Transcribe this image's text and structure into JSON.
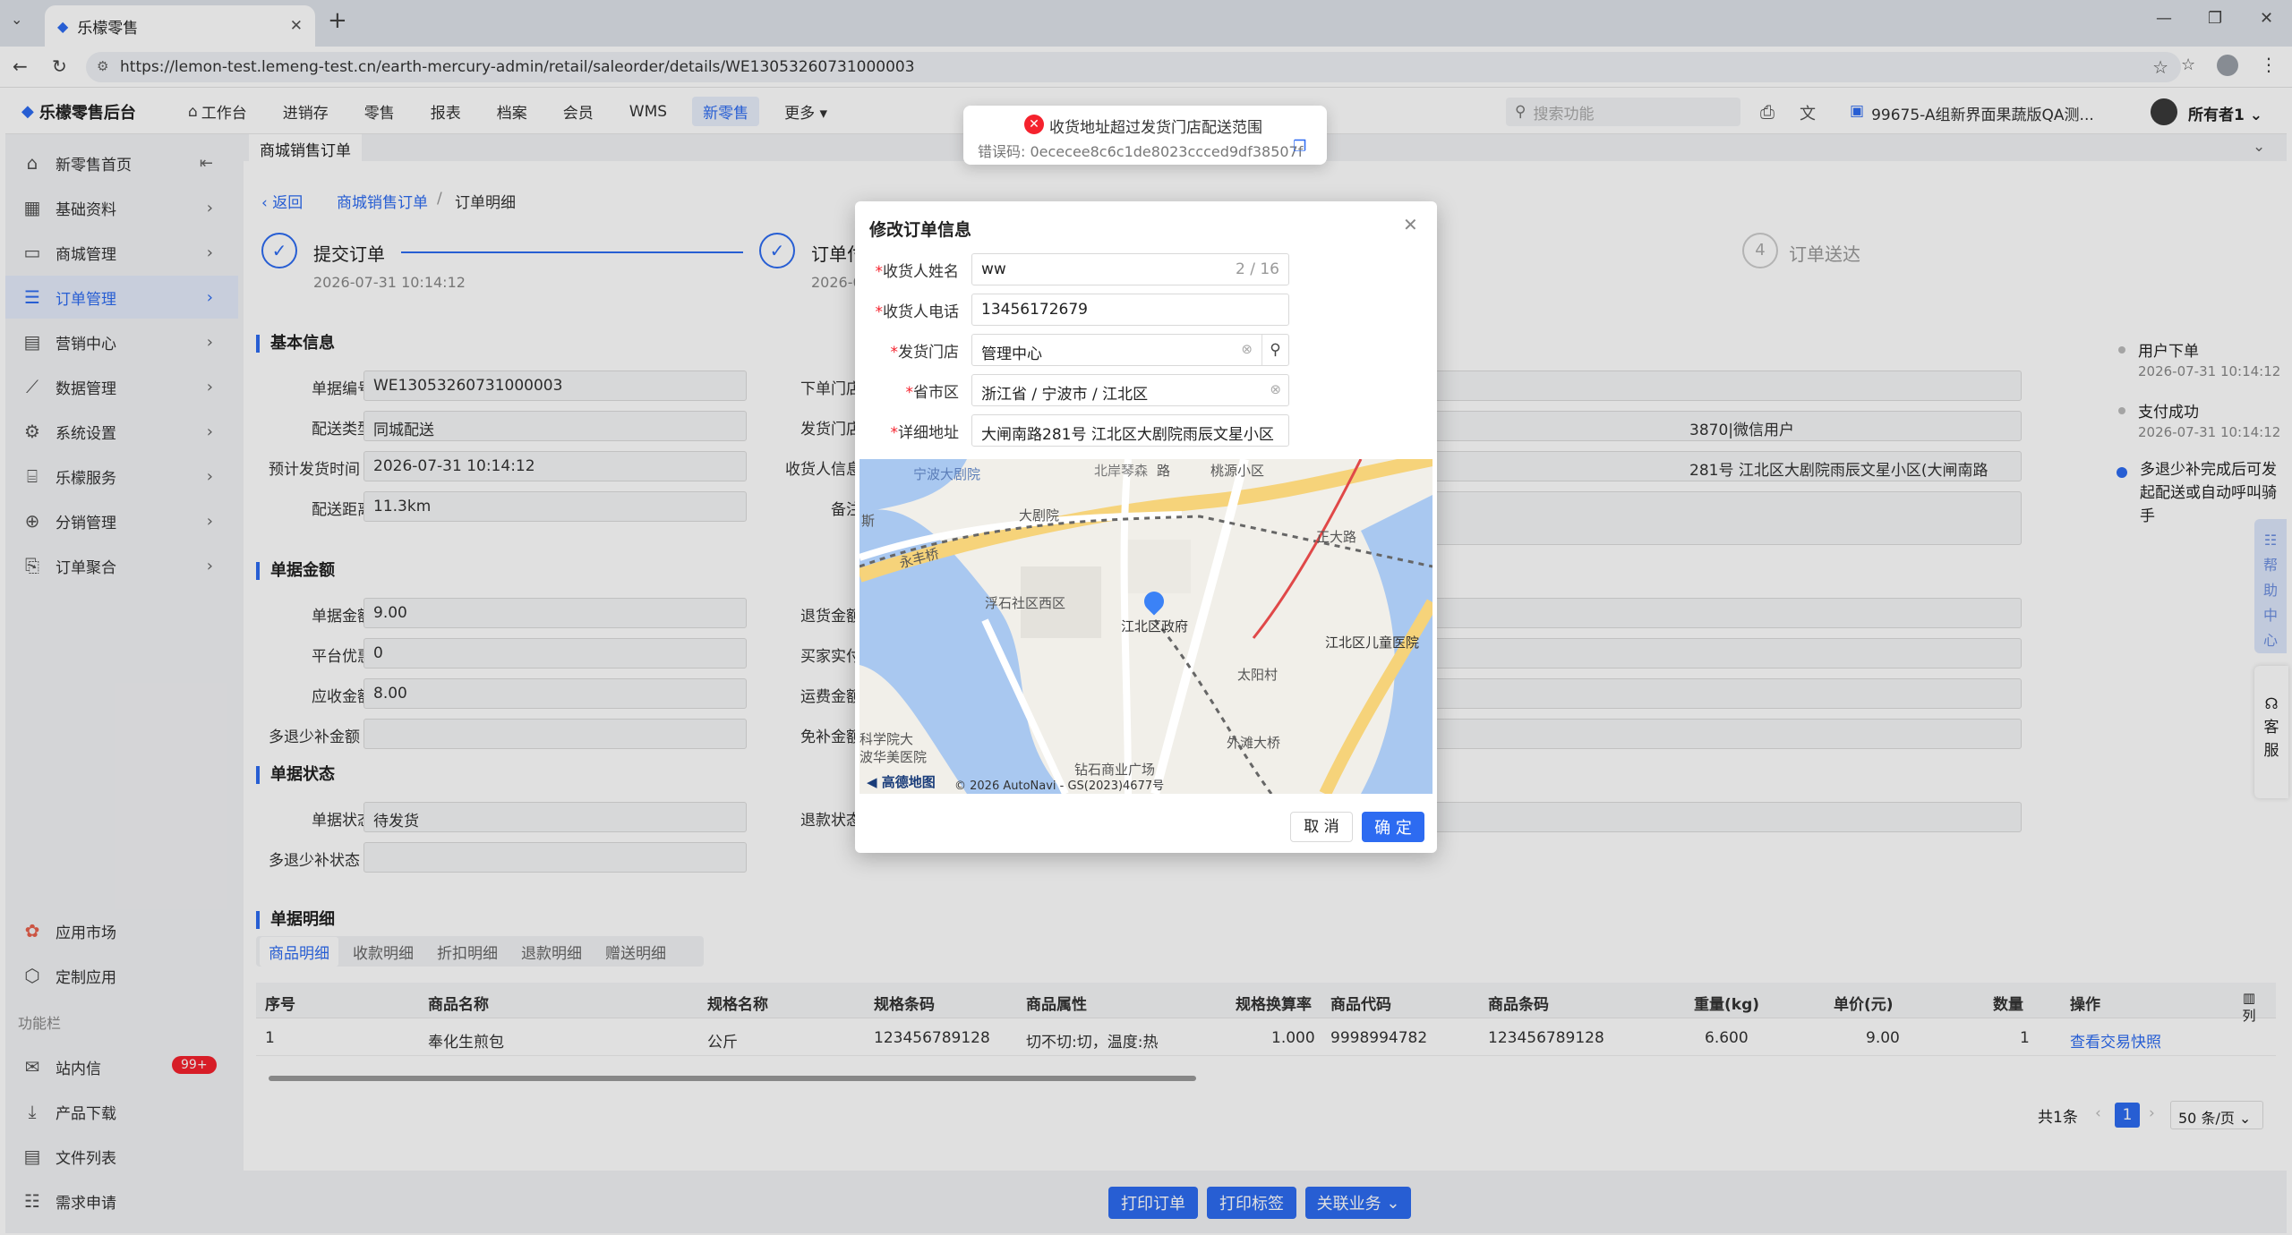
{
  "browser": {
    "tab_title": "乐檬零售",
    "url": "https://lemon-test.lemeng-test.cn/earth-mercury-admin/retail/saleorder/details/WE13053260731000003"
  },
  "app": {
    "logo": "乐檬零售后台",
    "search_placeholder": "搜索功能",
    "org": "99675-A组新界面果蔬版QA测...",
    "user": "所有者1"
  },
  "topnav": [
    "工作台",
    "进销存",
    "零售",
    "报表",
    "档案",
    "会员",
    "WMS",
    "新零售",
    "更多"
  ],
  "sidebar": {
    "items": [
      "新零售首页",
      "基础资料",
      "商城管理",
      "订单管理",
      "营销中心",
      "数据管理",
      "系统设置",
      "乐檬服务",
      "分销管理",
      "订单聚合"
    ],
    "bottom": [
      "应用市场",
      "定制应用"
    ],
    "section": "功能栏",
    "tools": [
      "站内信",
      "产品下载",
      "文件列表",
      "需求申请"
    ],
    "badge": "99+"
  },
  "page": {
    "tab": "商城销售订单",
    "back": "返回",
    "crumb1": "商城销售订单",
    "crumb_sep": "/",
    "crumb2": "订单明细"
  },
  "steps": [
    {
      "label": "提交订单",
      "time": "2026-07-31 10:14:12"
    },
    {
      "label": "订单付",
      "time": "2026-07"
    },
    {
      "num": "4",
      "label": "订单送达"
    }
  ],
  "basic": {
    "title": "基本信息",
    "rows": [
      [
        "单据编号",
        "WE13053260731000003"
      ],
      [
        "配送类型",
        "同城配送"
      ],
      [
        "预计发货时间",
        "2026-07-31 10:14:12"
      ],
      [
        "配送距离",
        "11.3km"
      ]
    ],
    "right_labels": [
      "下单门店",
      "发货门店",
      "收货人信息",
      "备注"
    ],
    "right_values": [
      "",
      "3870|微信用户",
      "281号 江北区大剧院雨辰文星小区(大闸南路",
      ""
    ]
  },
  "amount": {
    "title": "单据金额",
    "rows": [
      [
        "单据金额",
        "9.00"
      ],
      [
        "平台优惠",
        "0"
      ],
      [
        "应收金额",
        "8.00"
      ],
      [
        "多退少补金额",
        ""
      ]
    ],
    "right_labels": [
      "退货金额",
      "买家实付",
      "运费金额",
      "免补金额"
    ]
  },
  "status": {
    "title": "单据状态",
    "rows": [
      [
        "单据状态",
        "待发货"
      ],
      [
        "多退少补状态",
        ""
      ]
    ],
    "right_labels": [
      "退款状态"
    ]
  },
  "detail": {
    "title": "单据明细",
    "tabs": [
      "商品明细",
      "收款明细",
      "折扣明细",
      "退款明细",
      "赠送明细"
    ],
    "columns": [
      "序号",
      "商品名称",
      "规格名称",
      "规格条码",
      "商品属性",
      "规格换算率",
      "商品代码",
      "商品条码",
      "重量(kg)",
      "单价(元)",
      "数量",
      "操作"
    ],
    "row": [
      "1",
      "奉化生煎包",
      "公斤",
      "123456789128",
      "切不切:切，温度:热",
      "1.000",
      "9998994782",
      "123456789128",
      "6.600",
      "9.00",
      "1",
      "查看交易快照"
    ],
    "col_setting": "列",
    "total": "共1条",
    "page": "1",
    "page_size": "50 条/页"
  },
  "timeline": [
    {
      "title": "用户下单",
      "time": "2026-07-31 10:14:12"
    },
    {
      "title": "支付成功",
      "time": "2026-07-31 10:14:12"
    },
    {
      "title": "多退少补完成后可发起配送或自动呼叫骑手",
      "time": ""
    }
  ],
  "footer": {
    "print_order": "打印订单",
    "print_label": "打印标签",
    "related": "关联业务"
  },
  "help": {
    "help": "帮助中心",
    "service": "客服"
  },
  "toast": {
    "message": "收货地址超过发货门店配送范围",
    "error": "错误码: 0ececee8c6c1de8023ccced9df38507f"
  },
  "dialog": {
    "title": "修改订单信息",
    "fields": [
      {
        "label": "收货人姓名",
        "value": "ww",
        "count": "2 / 16"
      },
      {
        "label": "收货人电话",
        "value": "13456172679"
      },
      {
        "label": "发货门店",
        "value": "管理中心"
      },
      {
        "label": "省市区",
        "value": "浙江省 / 宁波市 / 江北区"
      },
      {
        "label": "详细地址",
        "value": "大闸南路281号 江北区大剧院雨辰文星小区"
      }
    ],
    "cancel": "取 消",
    "ok": "确 定"
  },
  "map": {
    "labels": [
      "宁波大剧院",
      "北岸琴森",
      "桃源小区",
      "大剧院",
      "正大路",
      "永丰桥",
      "浮石社区西区",
      "江北区政府",
      "江北区儿童医院",
      "太阳村",
      "外滩大桥",
      "钻石商业广场",
      "科学院大",
      "波华美医院",
      "路",
      "斯"
    ],
    "brand": "高德地图",
    "copyright": "© 2026 AutoNavi - GS(2023)4677号"
  }
}
